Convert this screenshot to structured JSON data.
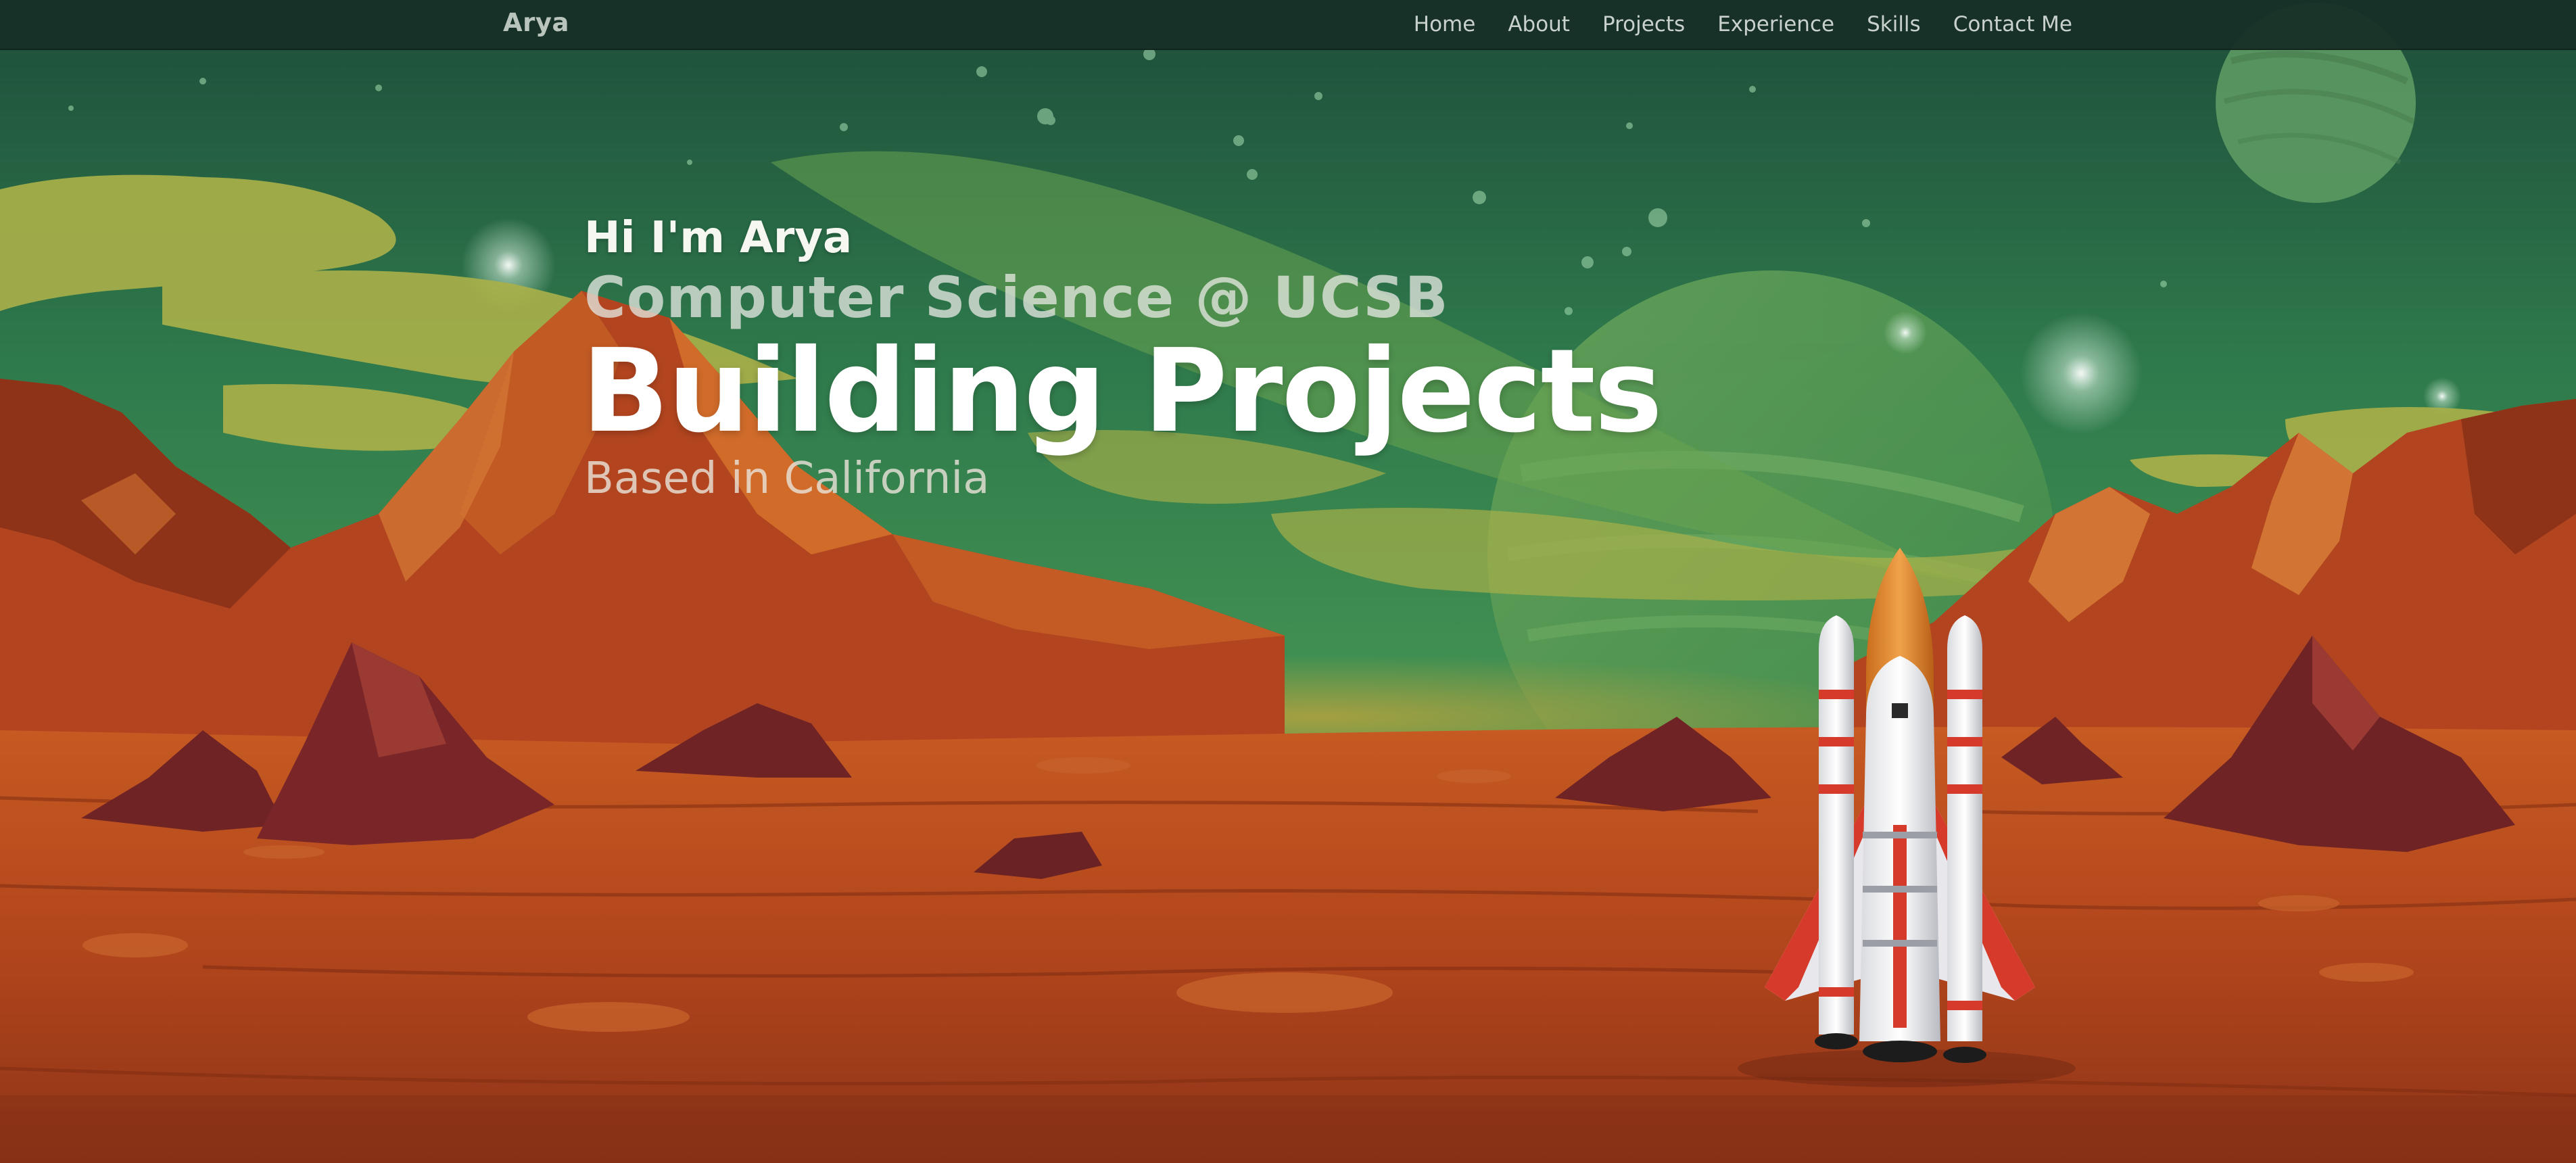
{
  "nav": {
    "brand": "Arya",
    "links": [
      "Home",
      "About",
      "Projects",
      "Experience",
      "Skills",
      "Contact Me"
    ]
  },
  "hero": {
    "greeting": "Hi I'm Arya",
    "subtitle": "Computer Science @ UCSB",
    "headline": "Building Projects",
    "location": "Based in California"
  },
  "colors": {
    "sky": "#2f7a4c",
    "clouds": "#a9b04a",
    "rock": "#b4491f",
    "ground": "#b8481e",
    "navbar": "#183028"
  }
}
